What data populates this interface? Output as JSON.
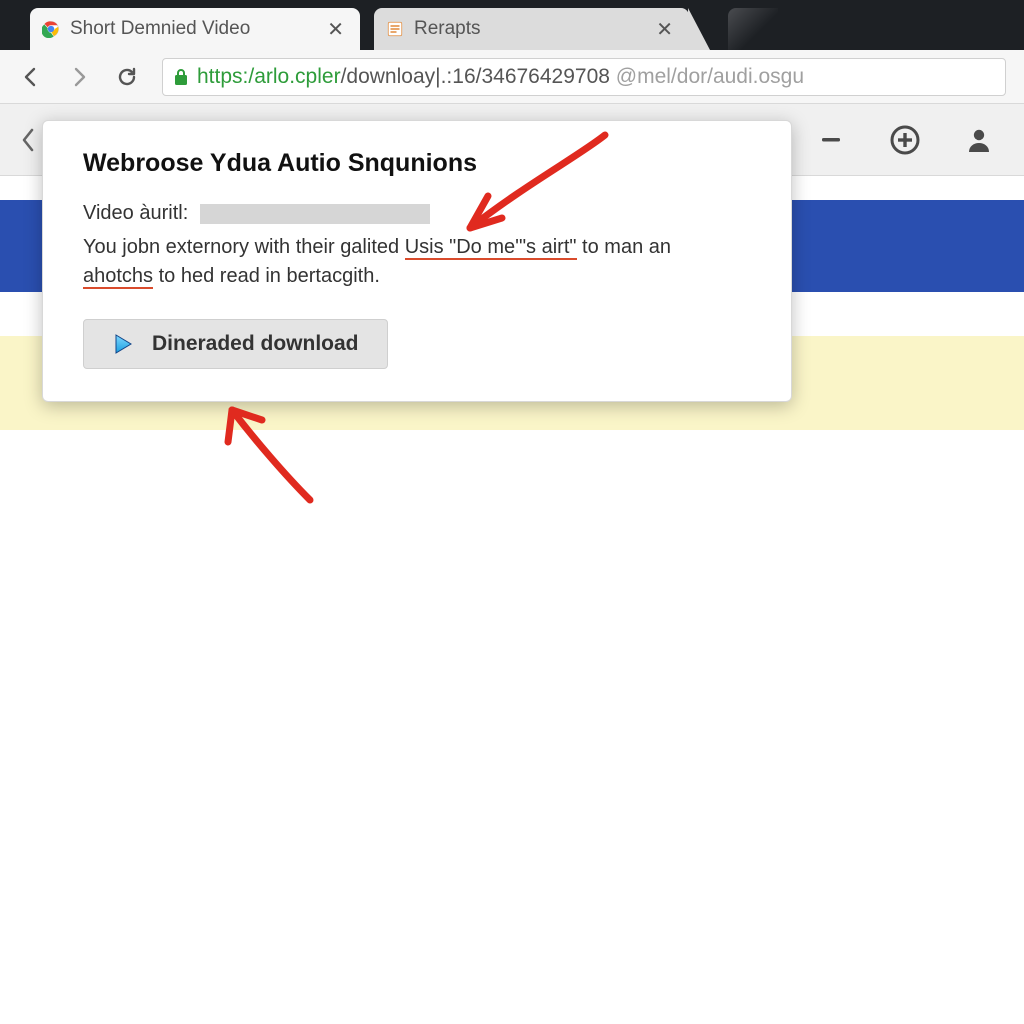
{
  "tabs": [
    {
      "title": "Short Demnied Video",
      "favicon": "chrome"
    },
    {
      "title": "Rerapts",
      "favicon": "orange-doc"
    }
  ],
  "address": {
    "scheme": "https:/",
    "host": "arlo.cpler",
    "path": "/downloay|.:16/34676429708",
    "tail": " @mel/dor/audi.osgu"
  },
  "popup": {
    "title": "Webroose Ydua Autio Snqunions",
    "field_label": "Video àuritl:",
    "desc_a": "You jobn externory with their galited ",
    "desc_link1": "Usis \"Do me'\"s airt\"",
    "desc_b": " to man an ",
    "desc_link2": "ahotchs",
    "desc_c": " to hed read in bertacgith.",
    "download_label": "Dineraded download"
  },
  "icons": {
    "minus": "−",
    "plus": "+",
    "person": "person"
  }
}
